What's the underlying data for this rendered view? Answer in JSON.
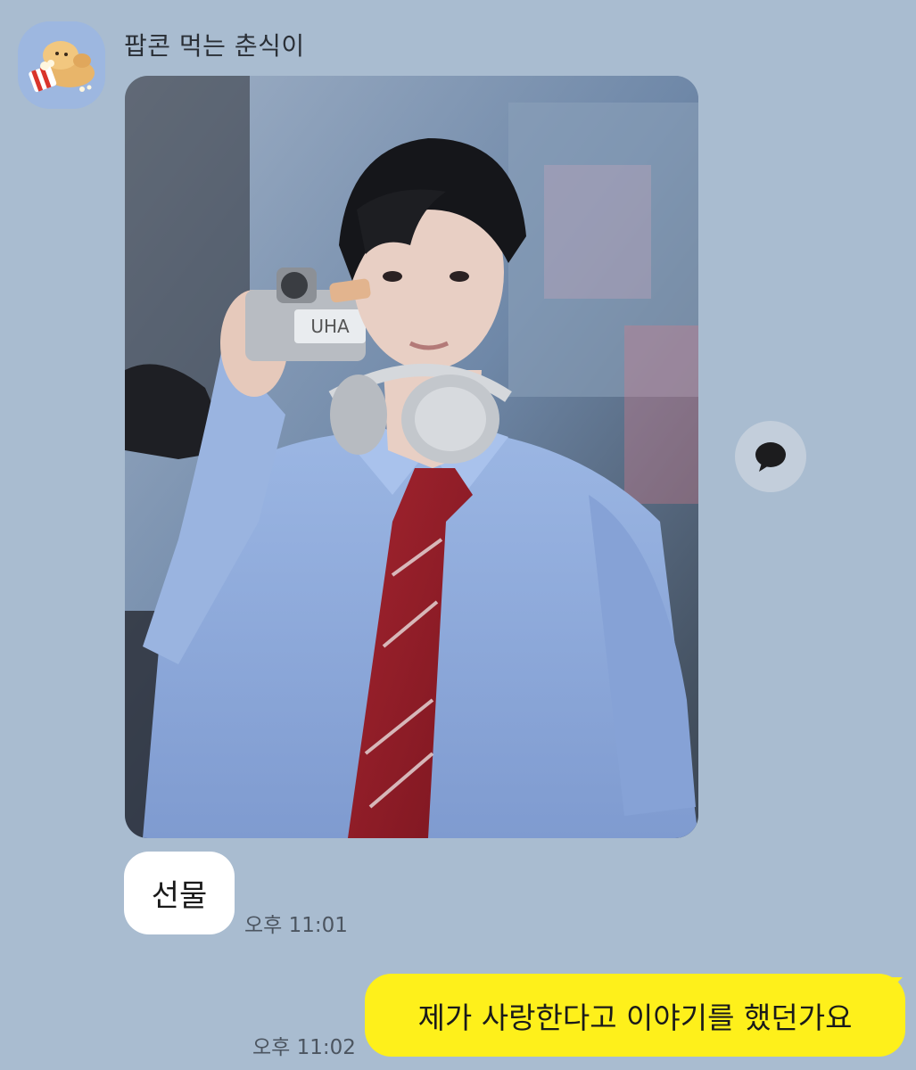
{
  "chat": {
    "sender_name": "팝콘 먹는 춘식이",
    "photo_sticker_text": "UHA",
    "messages": [
      {
        "direction": "received",
        "type": "text",
        "text": "선물",
        "time": "오후 11:01"
      },
      {
        "direction": "sent",
        "type": "text",
        "text": "제가 사랑한다고 이야기를 했던가요",
        "time": "오후 11:02"
      }
    ]
  },
  "icons": {
    "share": "speech-bubble-icon",
    "avatar": "popcorn-character-icon"
  },
  "colors": {
    "background": "#a9bcd0",
    "sent_bubble": "#fef01b",
    "received_bubble": "#ffffff",
    "share_button": "#c3cedb"
  }
}
